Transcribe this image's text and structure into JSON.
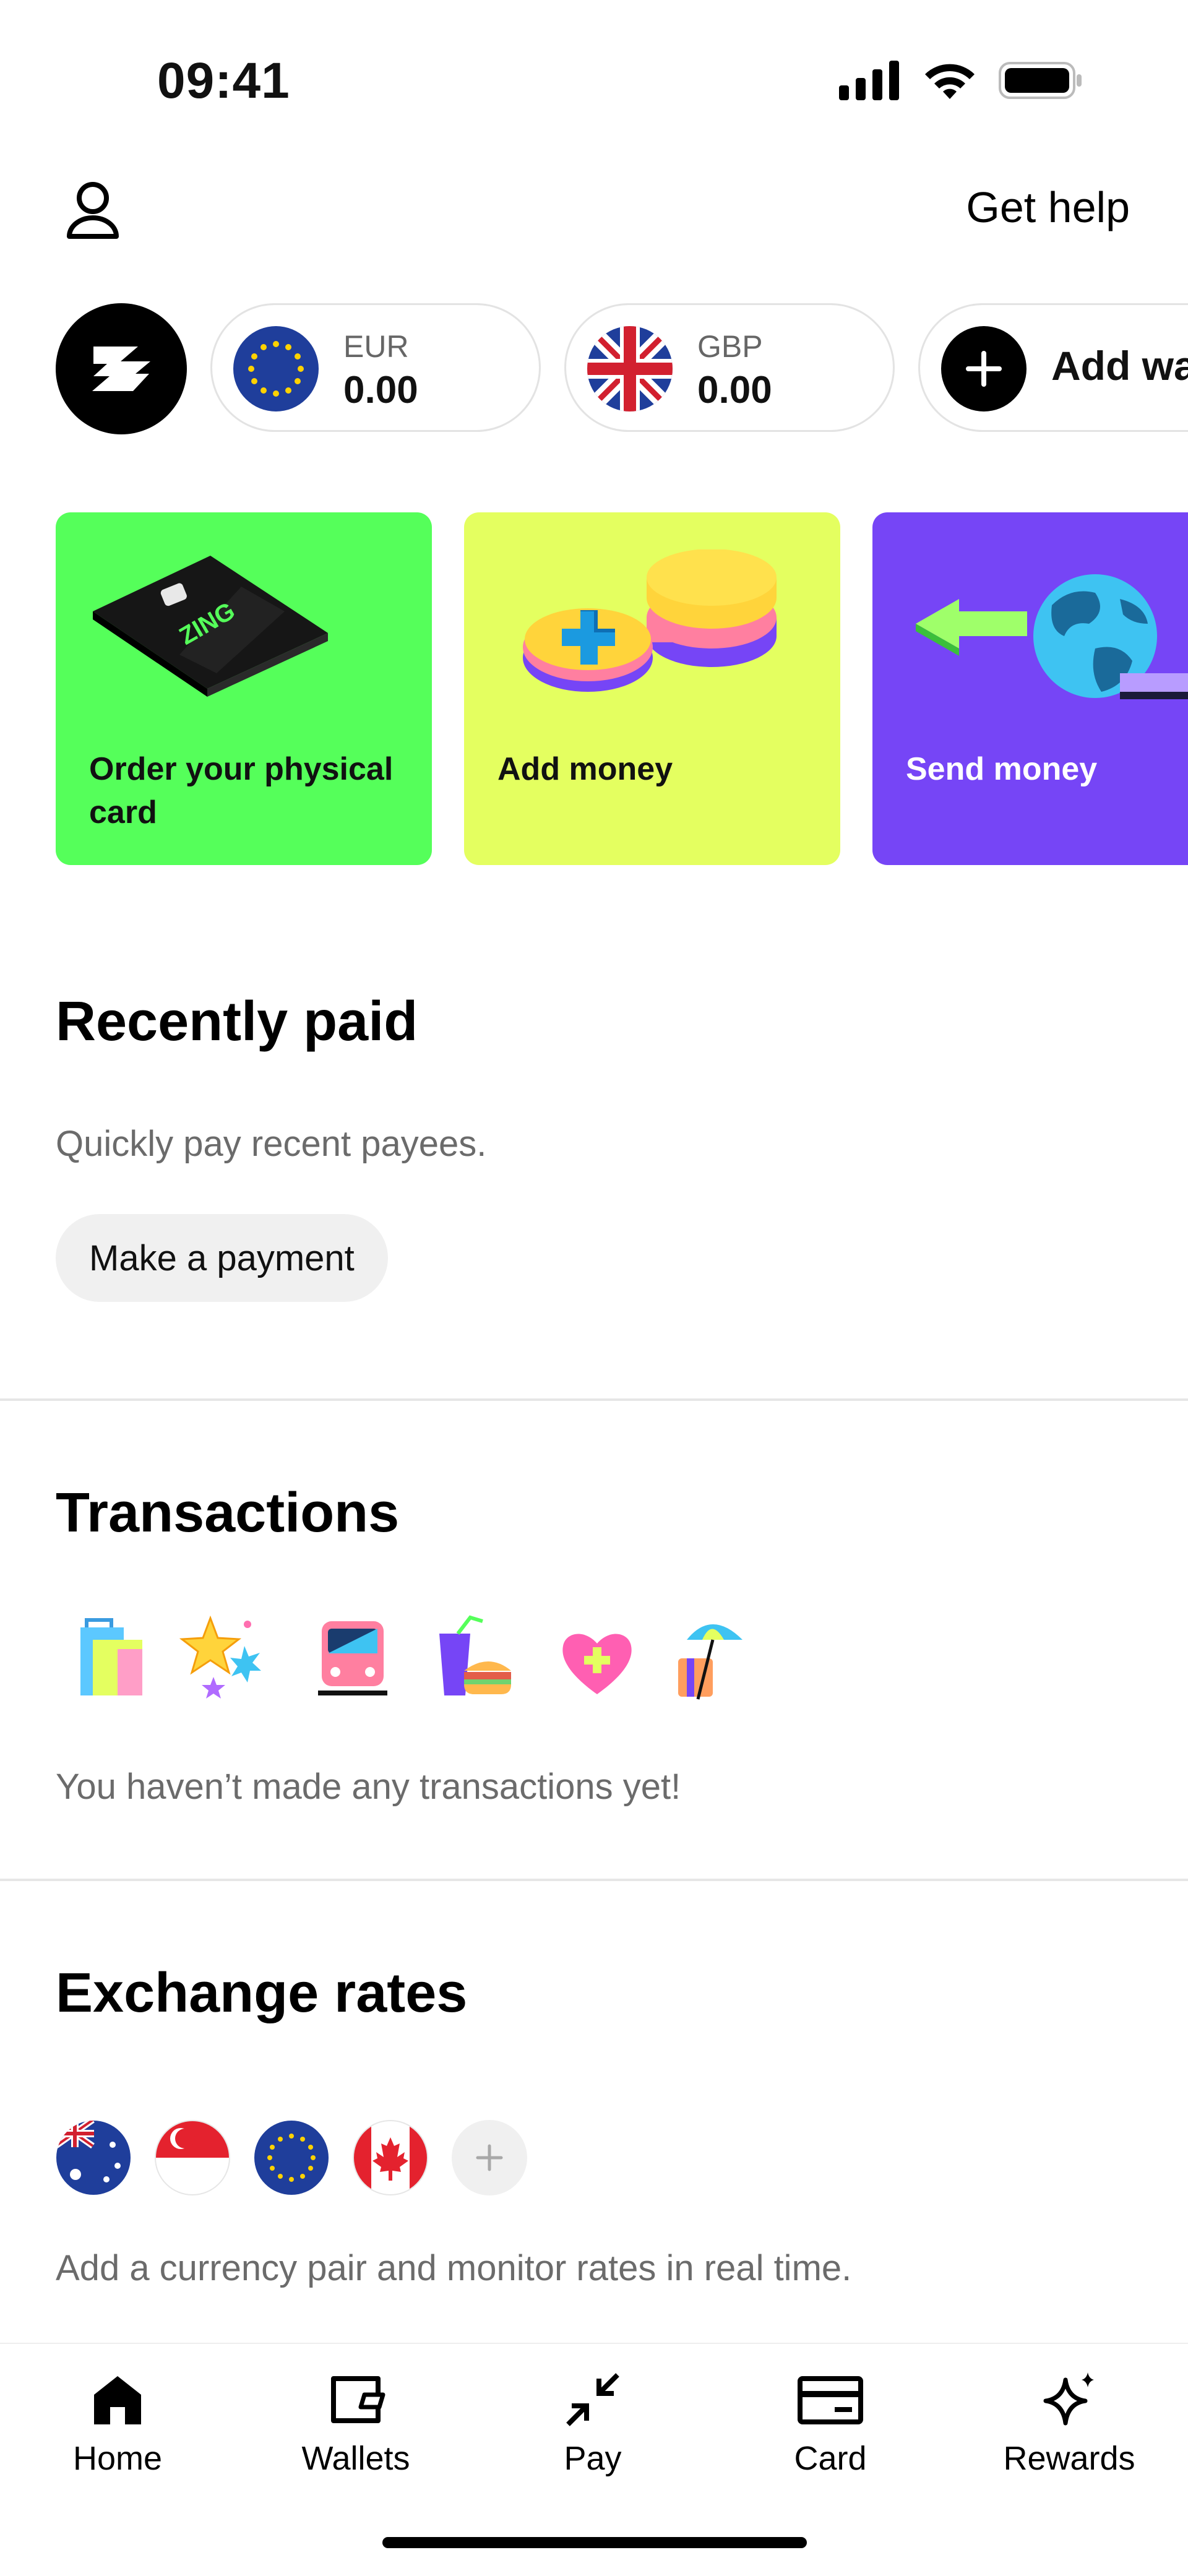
{
  "status_bar": {
    "time": "09:41"
  },
  "header": {
    "help_label": "Get help"
  },
  "wallets": [
    {
      "code": "EUR",
      "amount": "0.00",
      "flag": "eu-flag"
    },
    {
      "code": "GBP",
      "amount": "0.00",
      "flag": "uk-flag"
    }
  ],
  "add_wallet_label": "Add wal",
  "cards": [
    {
      "label": "Order your physical card",
      "color": "#55ff5a",
      "text_color": "#111111"
    },
    {
      "label": "Add money",
      "color": "#e4ff60",
      "text_color": "#111111"
    },
    {
      "label": "Send money",
      "color": "#7645f6",
      "text_color": "#ffffff"
    }
  ],
  "card_brand_text": "ZING",
  "recently_paid": {
    "title": "Recently paid",
    "subtitle": "Quickly pay recent payees.",
    "button_label": "Make a payment"
  },
  "transactions": {
    "title": "Transactions",
    "icons": [
      "shopping-bags-icon",
      "celebration-stars-icon",
      "train-icon",
      "fast-food-icon",
      "health-heart-icon",
      "travel-beach-icon"
    ],
    "empty_text": "You haven’t made any transactions yet!"
  },
  "exchange_rates": {
    "title": "Exchange rates",
    "flags": [
      "australia-flag",
      "singapore-flag",
      "eu-flag",
      "canada-flag"
    ],
    "subtitle": "Add a currency pair and monitor rates in real time."
  },
  "nav": [
    {
      "label": "Home",
      "icon": "home-icon",
      "active": true
    },
    {
      "label": "Wallets",
      "icon": "wallet-icon"
    },
    {
      "label": "Pay",
      "icon": "pay-arrows-icon"
    },
    {
      "label": "Card",
      "icon": "card-icon"
    },
    {
      "label": "Rewards",
      "icon": "sparkle-icon"
    }
  ],
  "colors": {
    "accent_green": "#55ff5a",
    "accent_yellow": "#e4ff60",
    "accent_purple": "#7645f6",
    "eu_blue": "#1f3e9b",
    "text_muted": "#6b6b6b"
  }
}
